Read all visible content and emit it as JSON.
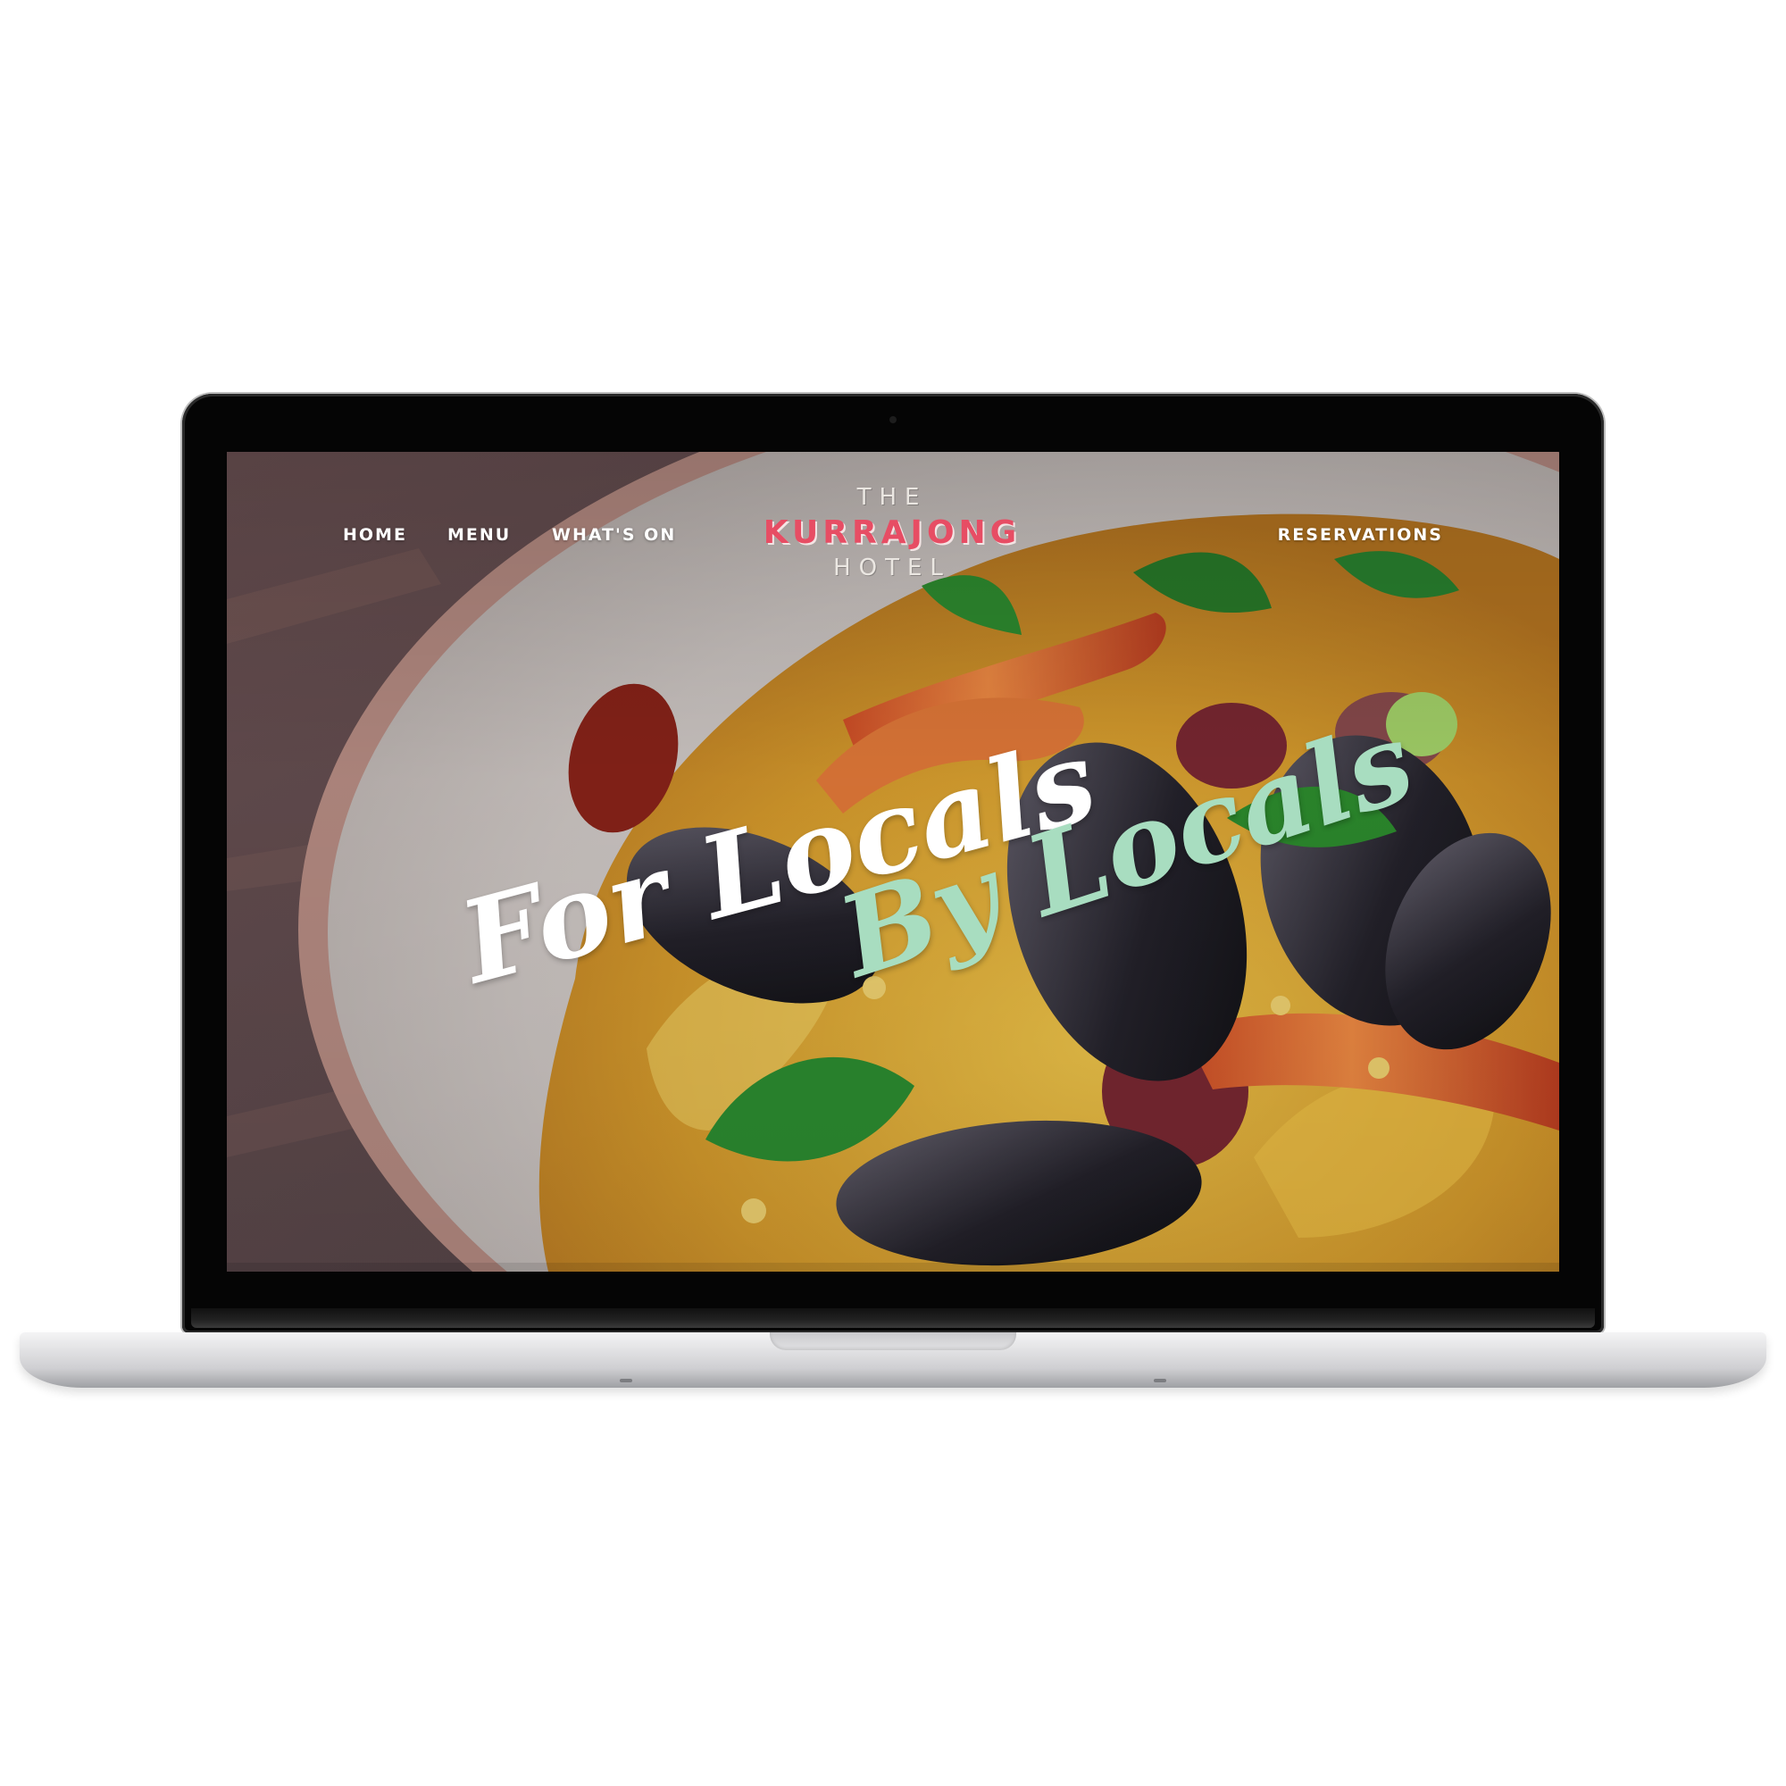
{
  "nav": {
    "home": "HOME",
    "menu": "MENU",
    "whats_on": "WHAT'S ON",
    "reservations": "RESERVATIONS"
  },
  "logo": {
    "the": "THE",
    "name": "KURRAJONG",
    "hotel": "HOTEL"
  },
  "hero": {
    "headline_1": "For Locals",
    "headline_2": "By Locals"
  },
  "colors": {
    "brand_red": "#e74d64",
    "mint_script": "#a8ddc0",
    "white_script": "#ffffff"
  },
  "icons": {
    "device": "laptop-icon",
    "camera": "camera-icon"
  }
}
